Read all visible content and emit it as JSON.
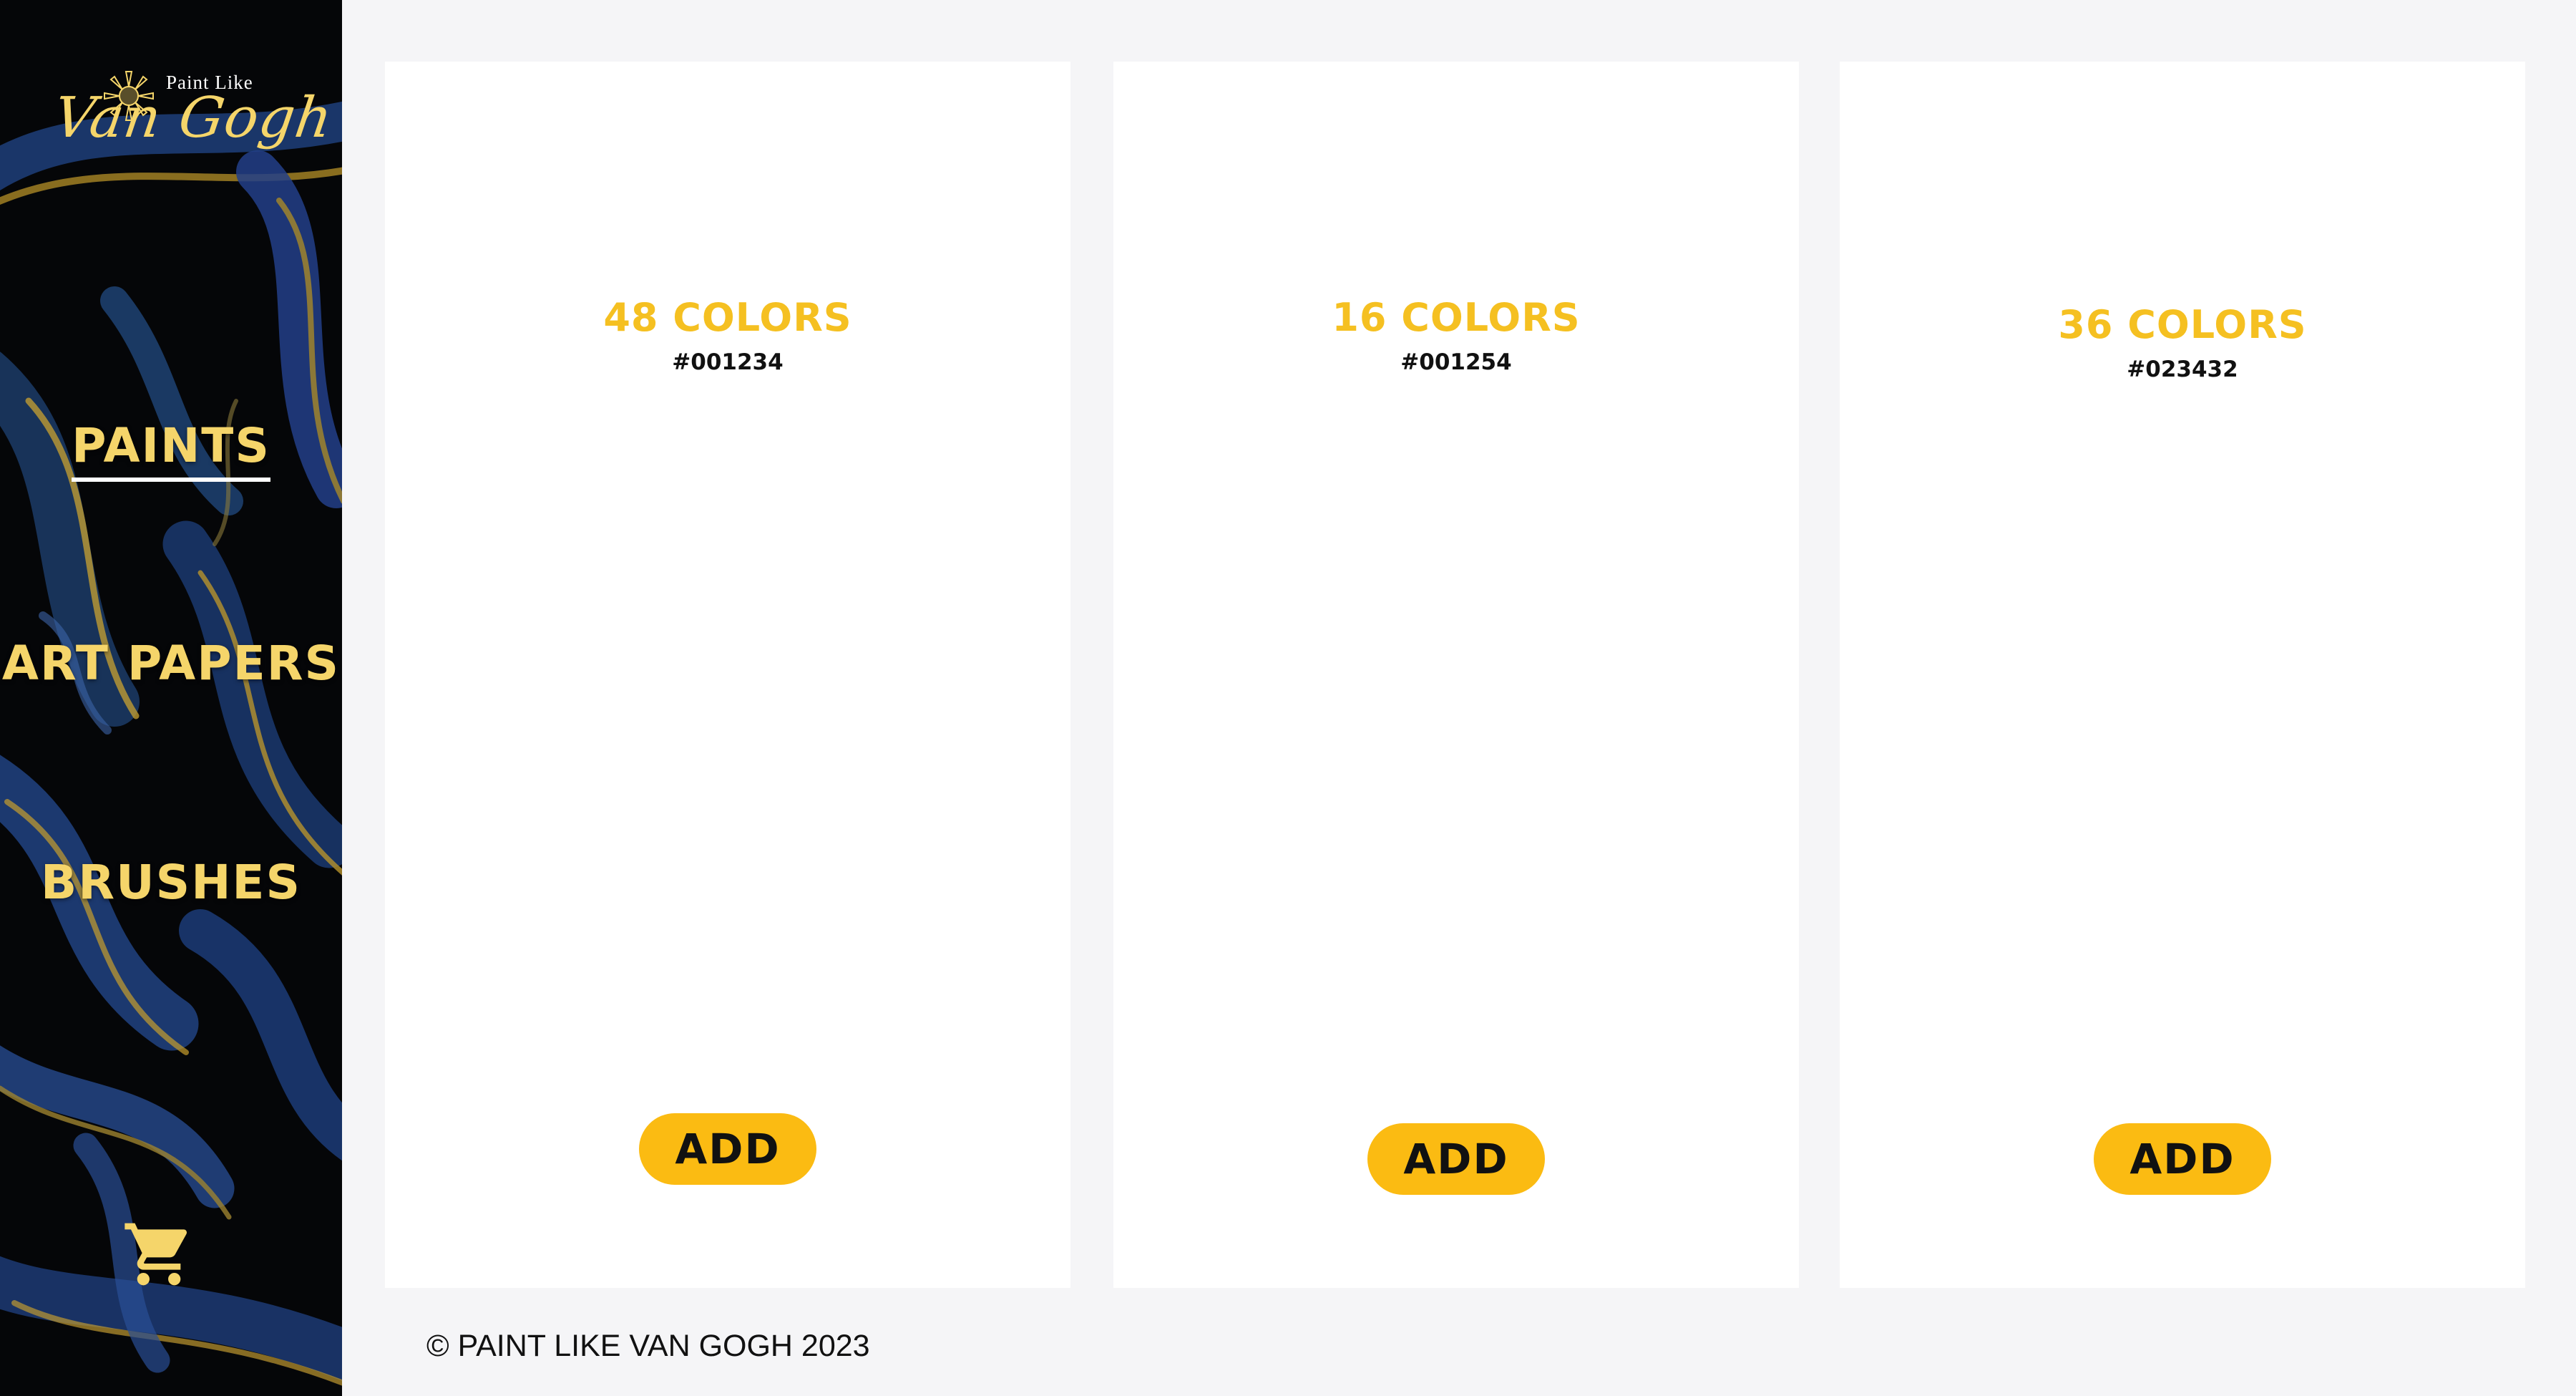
{
  "brand": {
    "small_text": "Paint Like",
    "script_text": "Van Gogh",
    "accent_color": "#f5d56a"
  },
  "sidebar": {
    "items": [
      {
        "label": "PAINTS",
        "active": true
      },
      {
        "label": "ART PAPERS",
        "active": false
      },
      {
        "label": "BRUSHES",
        "active": false
      }
    ],
    "cart_icon": "shopping-cart-icon"
  },
  "products": [
    {
      "title": "48 COLORS",
      "code": "#001234",
      "button": "ADD"
    },
    {
      "title": "16 COLORS",
      "code": "#001254",
      "button": "ADD"
    },
    {
      "title": "36 COLORS",
      "code": "#023432",
      "button": "ADD"
    }
  ],
  "footer": {
    "text": "© PAINT LIKE VAN GOGH 2023"
  },
  "colors": {
    "title_yellow": "#f5c021",
    "button_yellow": "#fbbb12",
    "page_background": "#f5f5f7",
    "sidebar_background": "#050608"
  }
}
